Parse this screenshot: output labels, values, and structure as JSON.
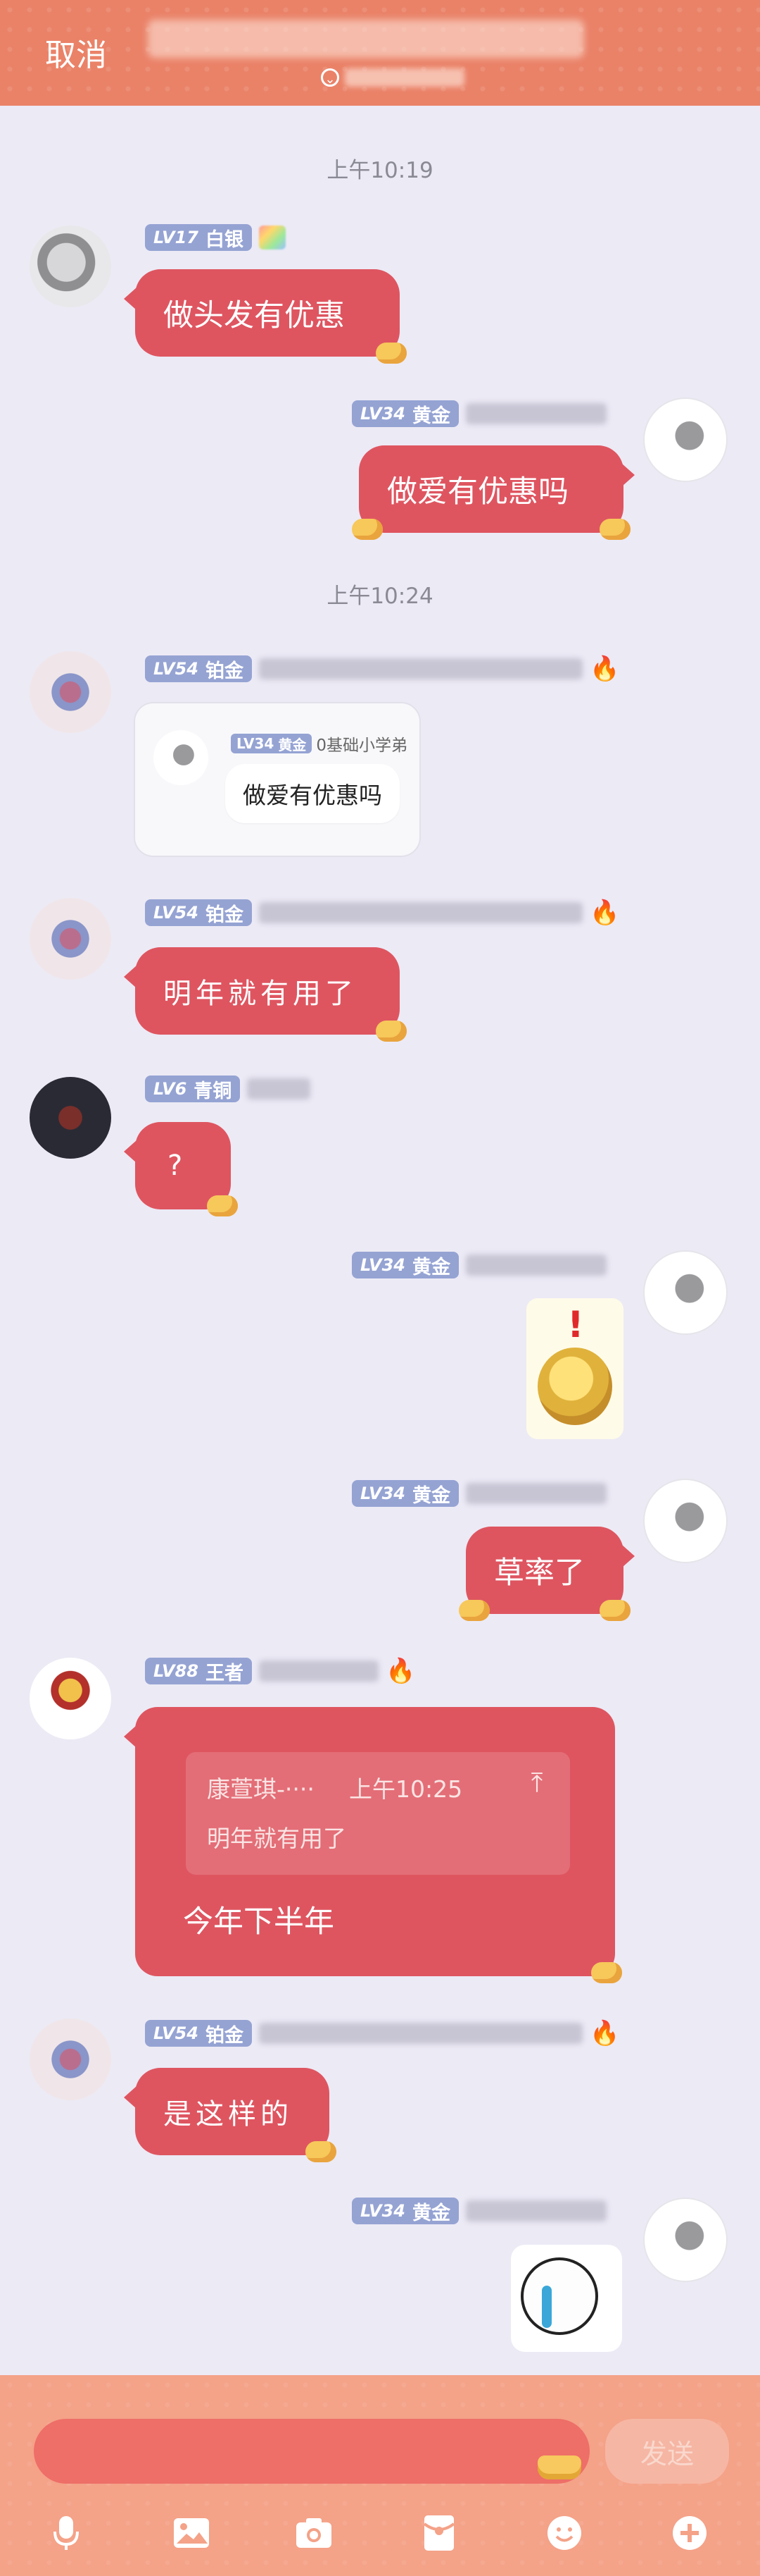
{
  "header": {
    "cancel_label": "取消"
  },
  "messages": {
    "time1": "上午10:19",
    "m1": {
      "level": "LV17",
      "rank": "白银",
      "text": "做头发有优惠"
    },
    "m2": {
      "level": "LV34",
      "rank": "黄金",
      "text": "做爱有优惠吗"
    },
    "time2": "上午10:24",
    "m3": {
      "level": "LV54",
      "rank": "铂金",
      "quote": {
        "level": "LV34",
        "rank": "黄金",
        "name": "0基础小学弟",
        "text": "做爱有优惠吗"
      }
    },
    "m4": {
      "level": "LV54",
      "rank": "铂金",
      "text": "明年就有用了"
    },
    "m5": {
      "level": "LV6",
      "rank": "青铜",
      "text": "?"
    },
    "m6": {
      "level": "LV34",
      "rank": "黄金"
    },
    "m7": {
      "level": "LV34",
      "rank": "黄金",
      "text": "草率了"
    },
    "m8": {
      "level": "LV88",
      "rank": "王者",
      "reply": {
        "name": "康萱琪-····",
        "time": "上午10:25",
        "quote": "明年就有用了"
      },
      "text": "今年下半年"
    },
    "m9": {
      "level": "LV54",
      "rank": "铂金",
      "text": "是这样的"
    },
    "m10": {
      "level": "LV34",
      "rank": "黄金"
    }
  },
  "composer": {
    "send_label": "发送"
  },
  "toolbar": {
    "icons": [
      "microphone-icon",
      "image-icon",
      "camera-icon",
      "red-packet-icon",
      "emoji-icon",
      "plus-icon"
    ]
  },
  "colors": {
    "bubble": "#de5560",
    "header": "#ea8268",
    "badge": "#95a3d3",
    "background": "#eceaf5"
  }
}
